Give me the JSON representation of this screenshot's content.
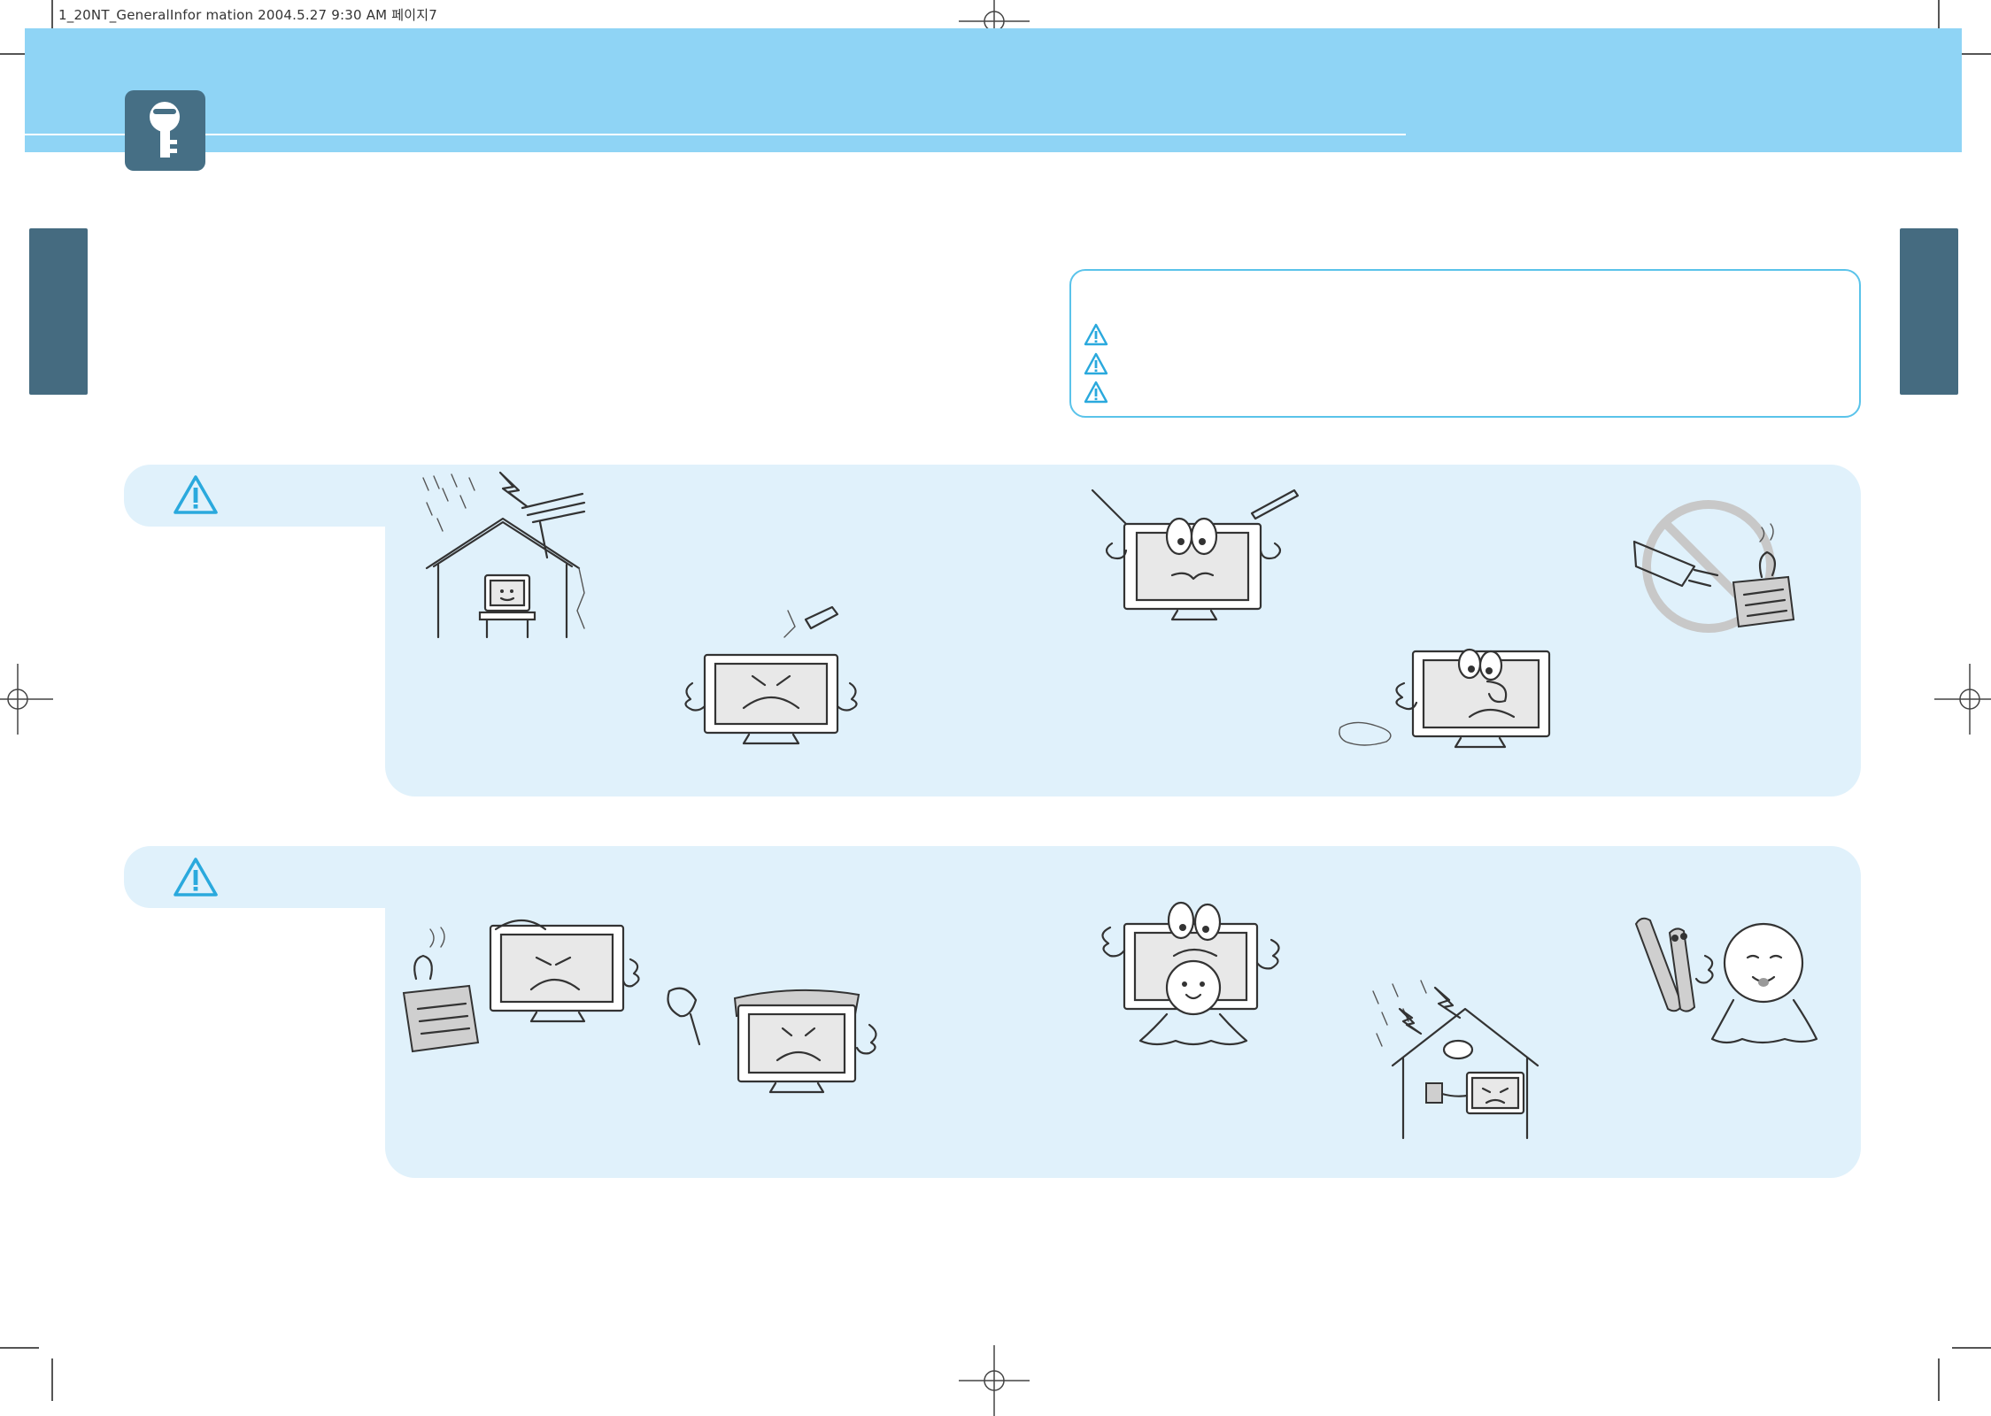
{
  "slug_line": "1_20NT_GeneralInfor mation  2004.5.27 9:30 AM 페이지7",
  "colors": {
    "header_band": "#8fd4f5",
    "key_badge": "#466f85",
    "side_tab": "#456b80",
    "panel": "#e0f1fb",
    "notice_border": "#5ac3ea",
    "warning_icon": "#2aa9dd"
  },
  "icons": {
    "header": "key-icon",
    "notice": "warning-triangle-icon",
    "panel": "warning-triangle-icon"
  },
  "notice_box": {
    "rows": 3
  },
  "panels": [
    {
      "illustration_count": 6
    },
    {
      "illustration_count": 6
    }
  ]
}
